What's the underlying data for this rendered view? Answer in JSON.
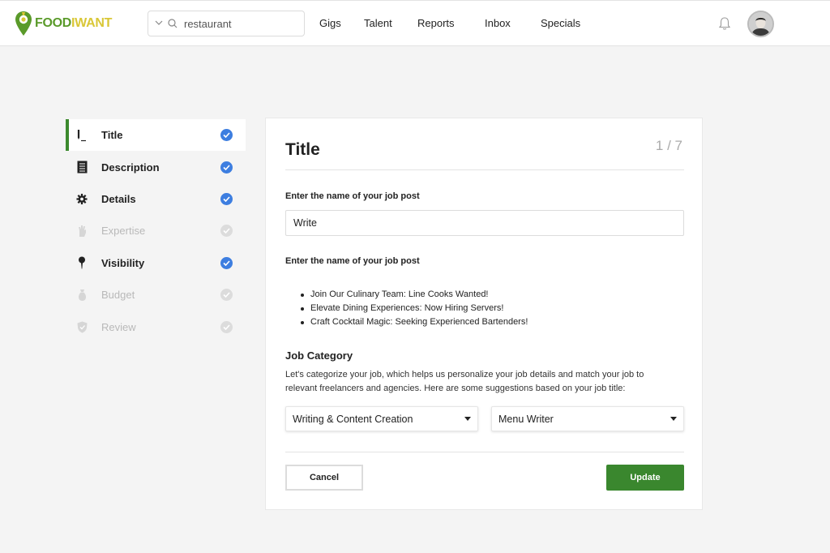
{
  "brand": {
    "name_part1": "FOOD",
    "name_part2": "IWANT",
    "icon": "location-pin-icon"
  },
  "search": {
    "value": "restaurant",
    "placeholder": "restaurant",
    "icon": "search-icon"
  },
  "nav": [
    "Gigs",
    "Talent",
    "Reports",
    "Inbox",
    "Specials"
  ],
  "header_icons": {
    "notifications": "bell-icon",
    "profile": "avatar"
  },
  "steps": [
    {
      "label": "Title",
      "icon": "pen-icon",
      "state": "active",
      "completed": true
    },
    {
      "label": "Description",
      "icon": "document-icon",
      "state": "normal",
      "completed": true
    },
    {
      "label": "Details",
      "icon": "gear-icon",
      "state": "normal",
      "completed": true
    },
    {
      "label": "Expertise",
      "icon": "hand-icon",
      "state": "disabled",
      "completed": false
    },
    {
      "label": "Visibility",
      "icon": "pin-icon",
      "state": "normal",
      "completed": true
    },
    {
      "label": "Budget",
      "icon": "money-bag-icon",
      "state": "disabled",
      "completed": false
    },
    {
      "label": "Review",
      "icon": "shield-icon",
      "state": "disabled",
      "completed": false
    }
  ],
  "panel": {
    "title": "Title",
    "step_counter": "1 / 7",
    "name_label": "Enter the name of your job post",
    "name_value": "Write",
    "examples_label": "Enter the name of your job post",
    "examples": [
      "Join Our Culinary Team: Line Cooks Wanted!",
      "Elevate Dining Experiences: Now Hiring Servers!",
      "Craft Cocktail Magic: Seeking Experienced Bartenders!"
    ],
    "category_title": "Job Category",
    "category_description": "Let's categorize your job, which helps us personalize your job details and match your job to relevant freelancers and agencies. Here are some suggestions based on your job title:",
    "category_select": "Writing & Content Creation",
    "subcategory_select": "Menu Writer",
    "cancel_label": "Cancel",
    "update_label": "Update"
  },
  "colors": {
    "accent_green": "#3a872e",
    "check_blue": "#3d7ee0",
    "logo_green": "#5a9a2a",
    "logo_yellow": "#d9c737"
  }
}
